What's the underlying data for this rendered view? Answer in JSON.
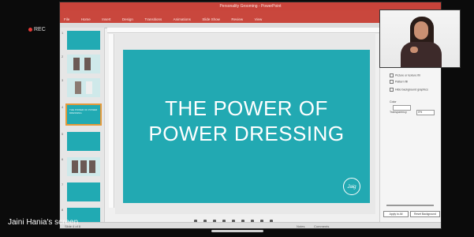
{
  "recording": {
    "label": "REC",
    "color": "#e53935"
  },
  "app": {
    "title": "Personality Grooming - PowerPoint",
    "ribbon_tabs": [
      "File",
      "Home",
      "Insert",
      "Design",
      "Transitions",
      "Animations",
      "Slide Show",
      "Review",
      "View"
    ],
    "accent": "#c9473d"
  },
  "thumbnails": [
    {
      "num": "1",
      "text": ""
    },
    {
      "num": "2",
      "text": ""
    },
    {
      "num": "3",
      "text": ""
    },
    {
      "num": "4",
      "text": "THE POWER OF POWER DRESSING"
    },
    {
      "num": "5",
      "text": ""
    },
    {
      "num": "6",
      "text": ""
    },
    {
      "num": "7",
      "text": ""
    },
    {
      "num": "8",
      "text": ""
    }
  ],
  "slide": {
    "title_line1": "THE POWER OF",
    "title_line2": "POWER DRESSING",
    "background": "#22a9b2",
    "logo_text": "Jaig"
  },
  "format_pane": {
    "options": [
      "Picture or texture fill",
      "Pattern fill",
      "Hide background graphics"
    ],
    "color_label": "Color",
    "transparency_label": "Transparency",
    "transparency_value": "0%",
    "apply_all": "Apply to All",
    "reset": "Reset Background"
  },
  "statusbar": {
    "slide_info": "Slide 4 of 8",
    "notes": "Notes",
    "comments": "Comments"
  },
  "screen_share": {
    "label": "Jaini Hania's screen"
  }
}
